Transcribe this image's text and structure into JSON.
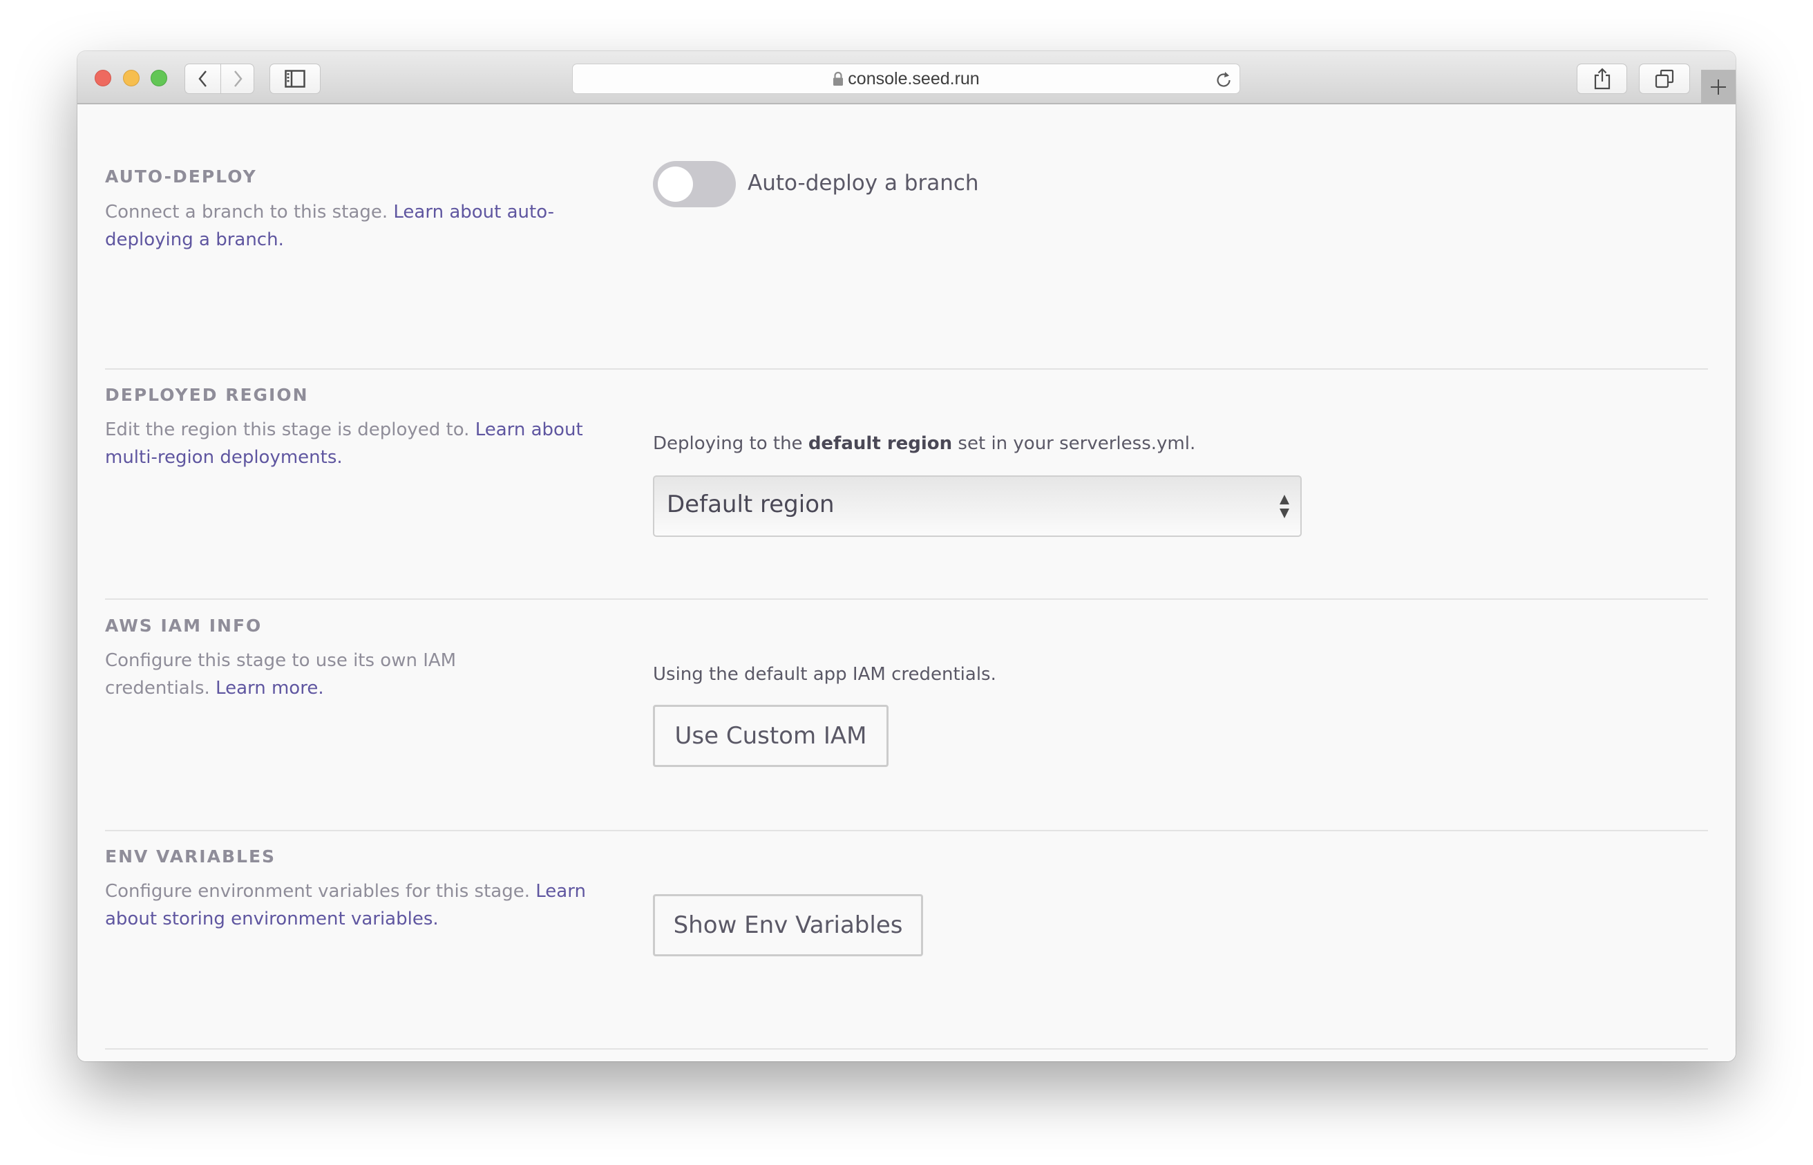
{
  "browser": {
    "url": "console.seed.run",
    "icons": {
      "back": "chevron-left-icon",
      "forward": "chevron-right-icon",
      "sidebar": "sidebar-icon",
      "lock": "lock-icon",
      "reload": "reload-icon",
      "share": "share-icon",
      "tabs": "tabs-overview-icon",
      "new_tab": "plus-icon"
    }
  },
  "colors": {
    "link": "#5f56a0",
    "muted_text": "#8f8d99",
    "body_text": "#5a5866",
    "toggle_off": "#c9c8cd",
    "background": "#f9f9f9"
  },
  "sections": {
    "auto_deploy": {
      "heading": "AUTO-DEPLOY",
      "desc_text": "Connect a branch to this stage. ",
      "desc_link": "Learn about auto-deploying a branch.",
      "toggle_label": "Auto-deploy a branch",
      "toggle_on": false
    },
    "region": {
      "heading": "DEPLOYED REGION",
      "desc_text": "Edit the region this stage is deployed to. ",
      "desc_link": "Learn about multi-region deployments.",
      "help_prefix": "Deploying to the ",
      "help_bold": "default region",
      "help_suffix": " set in your serverless.yml.",
      "select_value": "Default region"
    },
    "iam": {
      "heading": "AWS IAM INFO",
      "desc_text": "Configure this stage to use its own IAM credentials. ",
      "desc_link": "Learn more.",
      "help": "Using the default app IAM credentials.",
      "button": "Use Custom IAM"
    },
    "env": {
      "heading": "ENV VARIABLES",
      "desc_text": "Configure environment variables for this stage. ",
      "desc_link": "Learn about storing environment variables.",
      "button": "Show Env Variables"
    }
  }
}
